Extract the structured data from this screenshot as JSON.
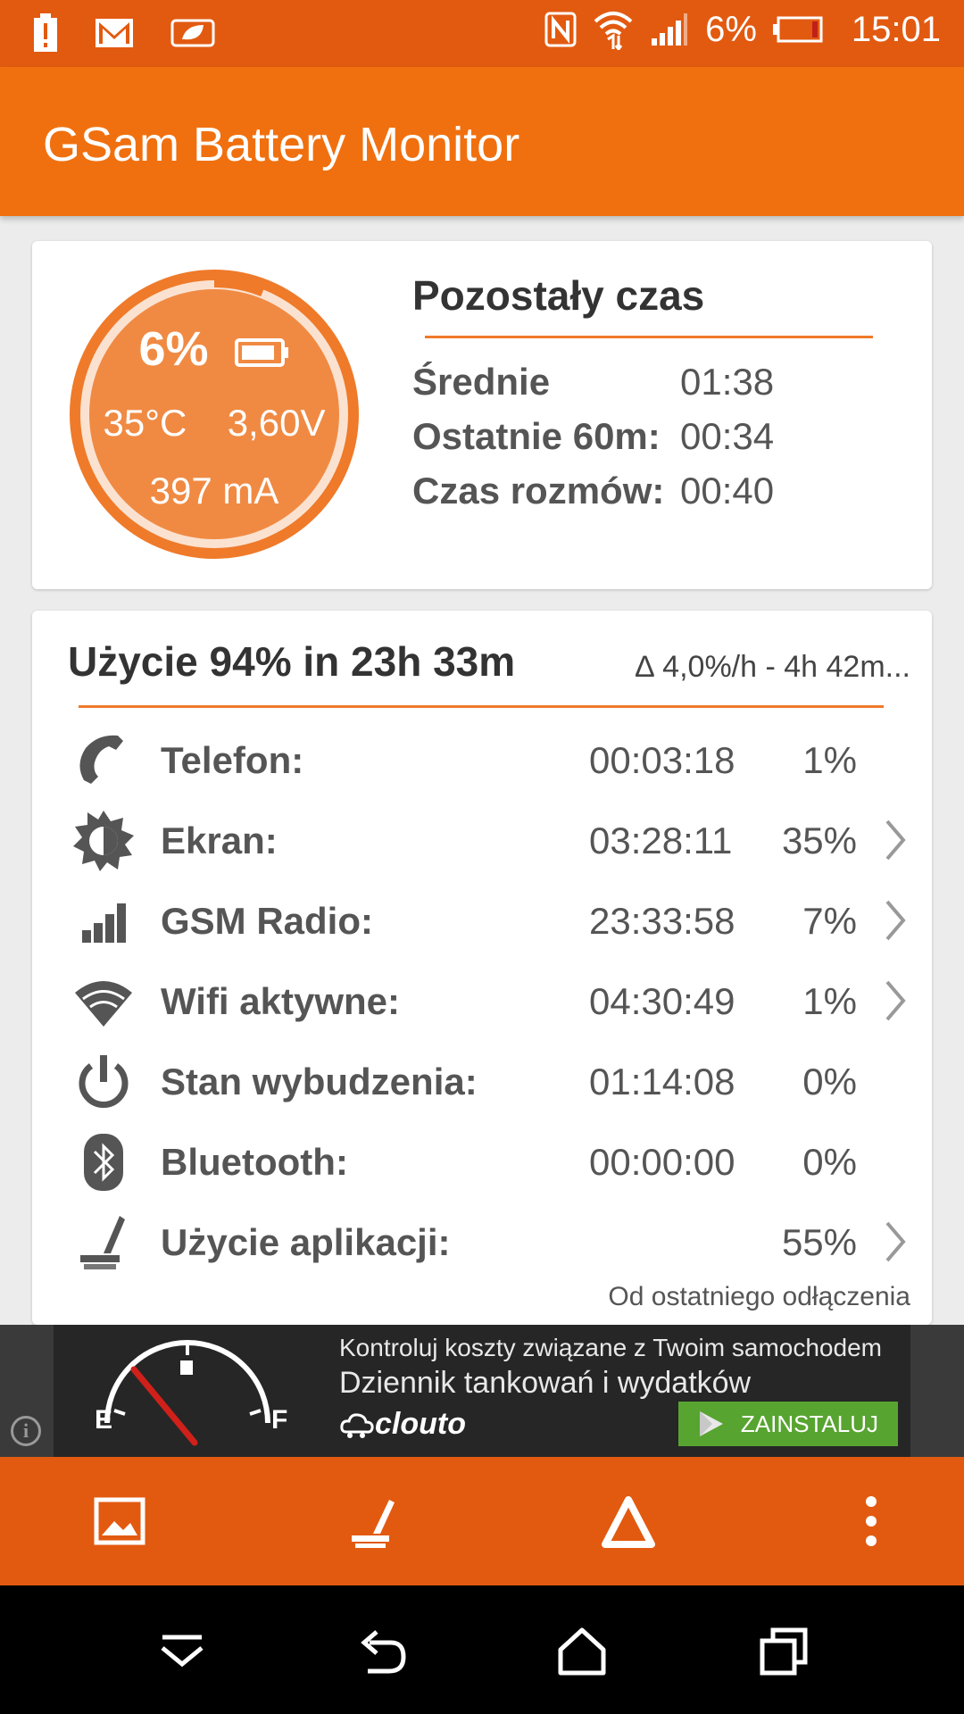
{
  "status_bar": {
    "battery_percent": "6%",
    "time": "15:01"
  },
  "app": {
    "title": "GSam Battery Monitor"
  },
  "battery": {
    "level_fraction": 0.06,
    "percent": "6%",
    "temperature": "35°C",
    "voltage": "3,60V",
    "current": "397 mA"
  },
  "remaining": {
    "title": "Pozostały czas",
    "rows": [
      {
        "label": "Średnie",
        "value": "01:38"
      },
      {
        "label": "Ostatnie 60m:",
        "value": "00:34"
      },
      {
        "label": "Czas rozmów:",
        "value": "00:40"
      }
    ]
  },
  "usage": {
    "title": "Użycie 94% in 23h 33m",
    "rate": "∆ 4,0%/h - 4h 42m...",
    "rows": [
      {
        "icon": "phone-icon",
        "name": "Telefon:",
        "time": "00:03:18",
        "percent": "1%",
        "has_details": false
      },
      {
        "icon": "brightness-icon",
        "name": "Ekran:",
        "time": "03:28:11",
        "percent": "35%",
        "has_details": true
      },
      {
        "icon": "signal-bars-icon",
        "name": "GSM Radio:",
        "time": "23:33:58",
        "percent": "7%",
        "has_details": true
      },
      {
        "icon": "wifi-icon",
        "name": "Wifi aktywne:",
        "time": "04:30:49",
        "percent": "1%",
        "has_details": true
      },
      {
        "icon": "power-icon",
        "name": "Stan wybudzenia:",
        "time": "01:14:08",
        "percent": "0%",
        "has_details": false
      },
      {
        "icon": "bluetooth-icon",
        "name": "Bluetooth:",
        "time": "00:00:00",
        "percent": "0%",
        "has_details": false
      },
      {
        "icon": "app-usage-icon",
        "name": "Użycie aplikacji:",
        "time": "",
        "percent": "55%",
        "has_details": true
      }
    ],
    "footnote": "Od ostatniego odłączenia"
  },
  "ad": {
    "line1": "Kontroluj koszty związane z Twoim samochodem",
    "line2": "Dziennik tankowań i wydatków",
    "brand": "clouto",
    "button": "ZAINSTALUJ",
    "gauge_e": "E",
    "gauge_f": "F",
    "info": "i"
  },
  "colors": {
    "status_bar": "#e25a10",
    "app_bar": "#f0700f",
    "accent": "#ef7a2a",
    "install_button": "#58a431"
  }
}
